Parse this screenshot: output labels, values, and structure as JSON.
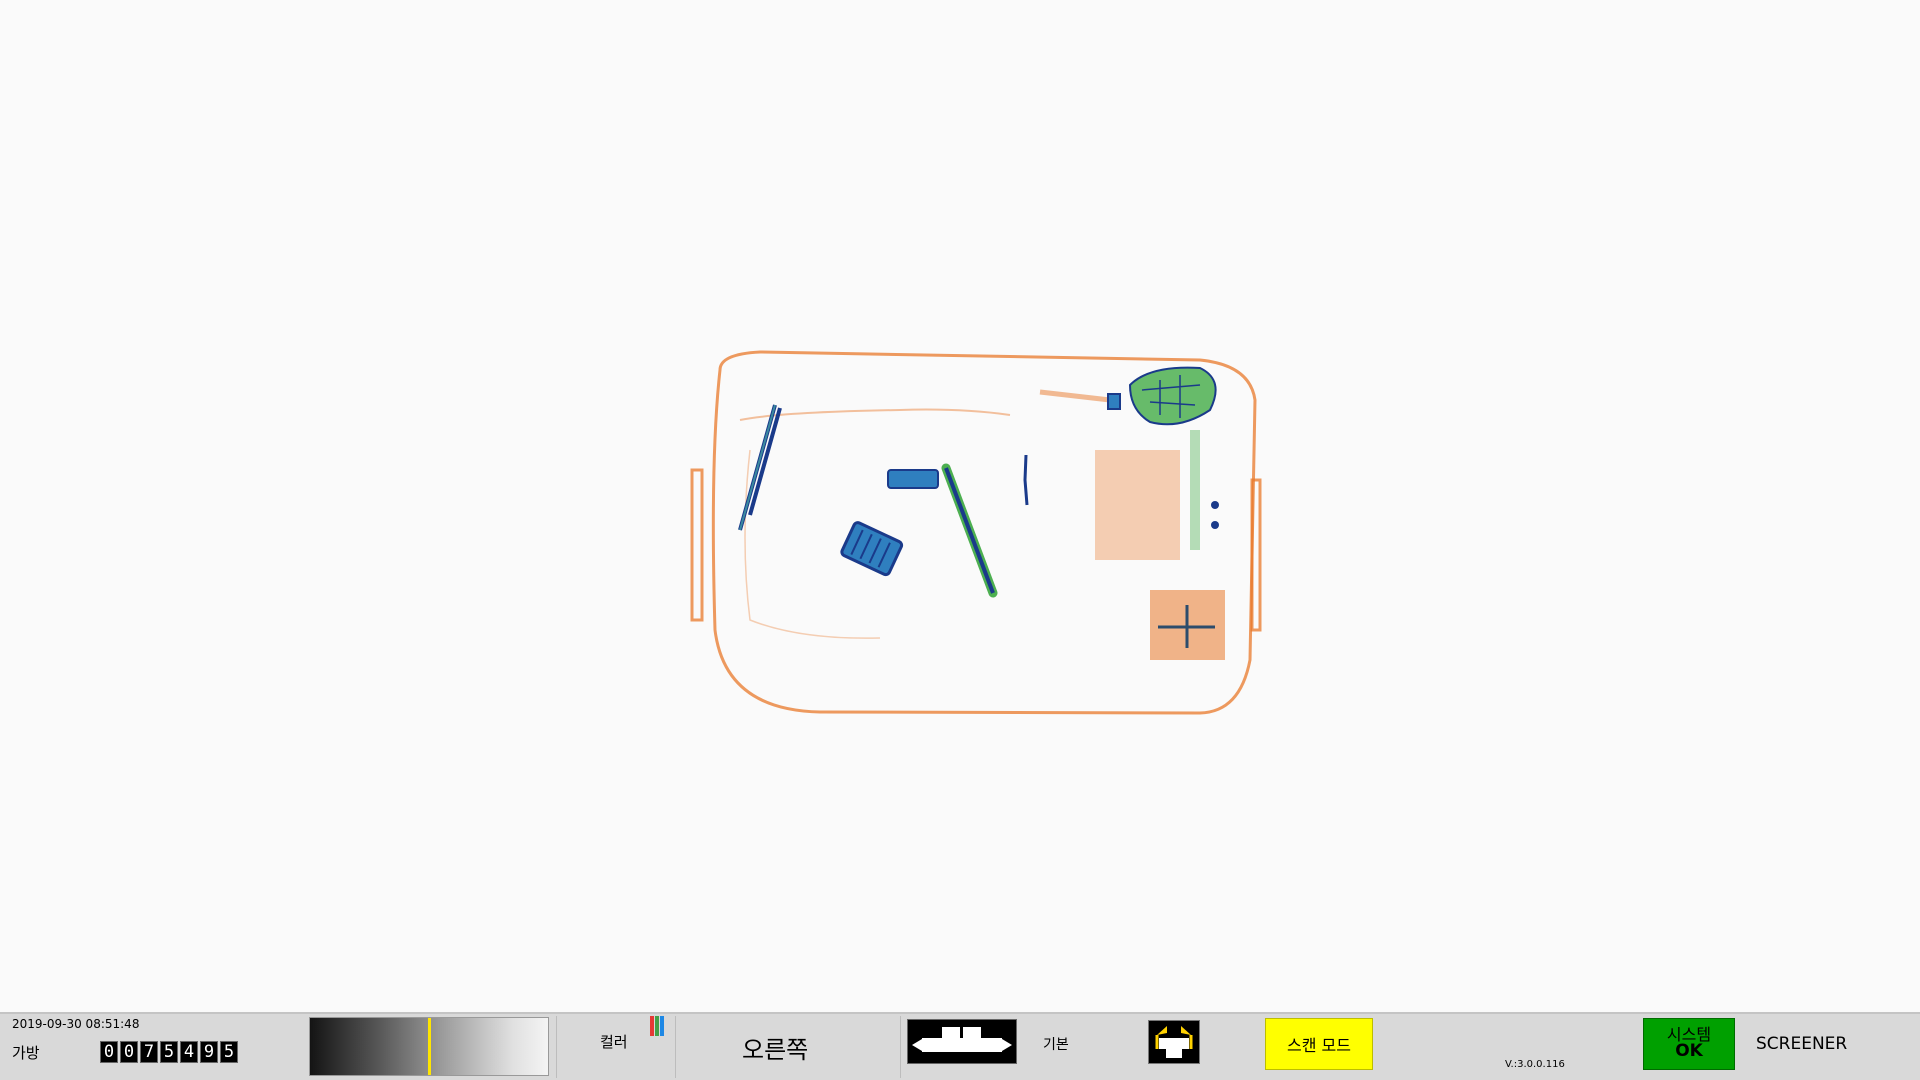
{
  "colors": {
    "background": "#fafafa",
    "status_bar": "#d9d9d9",
    "scan_mode_bg": "#ffff00",
    "system_ok_bg": "#00a000",
    "xray_organic": "#e8782a",
    "xray_inorganic": "#2f7fbf",
    "xray_mixed": "#4caf50",
    "xray_dense": "#1a3a8a"
  },
  "viewer": {
    "image_description": "x-ray scan image",
    "objects": [
      "bag-frame",
      "scissors",
      "battery-pack",
      "cylinder",
      "knife",
      "cable",
      "circuit-board",
      "laptop-block",
      "tool-block"
    ]
  },
  "status_bar": {
    "datetime": "2019-09-30 08:51:48",
    "bag_label": "가방",
    "bag_counter": [
      "0",
      "0",
      "7",
      "5",
      "4",
      "9",
      "5"
    ],
    "gray_level": 0.5,
    "color_label": "컬러",
    "color_icon": "rgb-bars-icon",
    "direction_label": "오른쪽",
    "belt_icon": "conveyor-belt-icon",
    "mode_label": "기본",
    "emergency_icon": "conveyor-stop-icon",
    "scan_mode_label": "스캔 모드",
    "version": "V.:3.0.0.116",
    "system_status_line1": "시스템",
    "system_status_line2": "OK",
    "user_label": "SCREENER"
  }
}
